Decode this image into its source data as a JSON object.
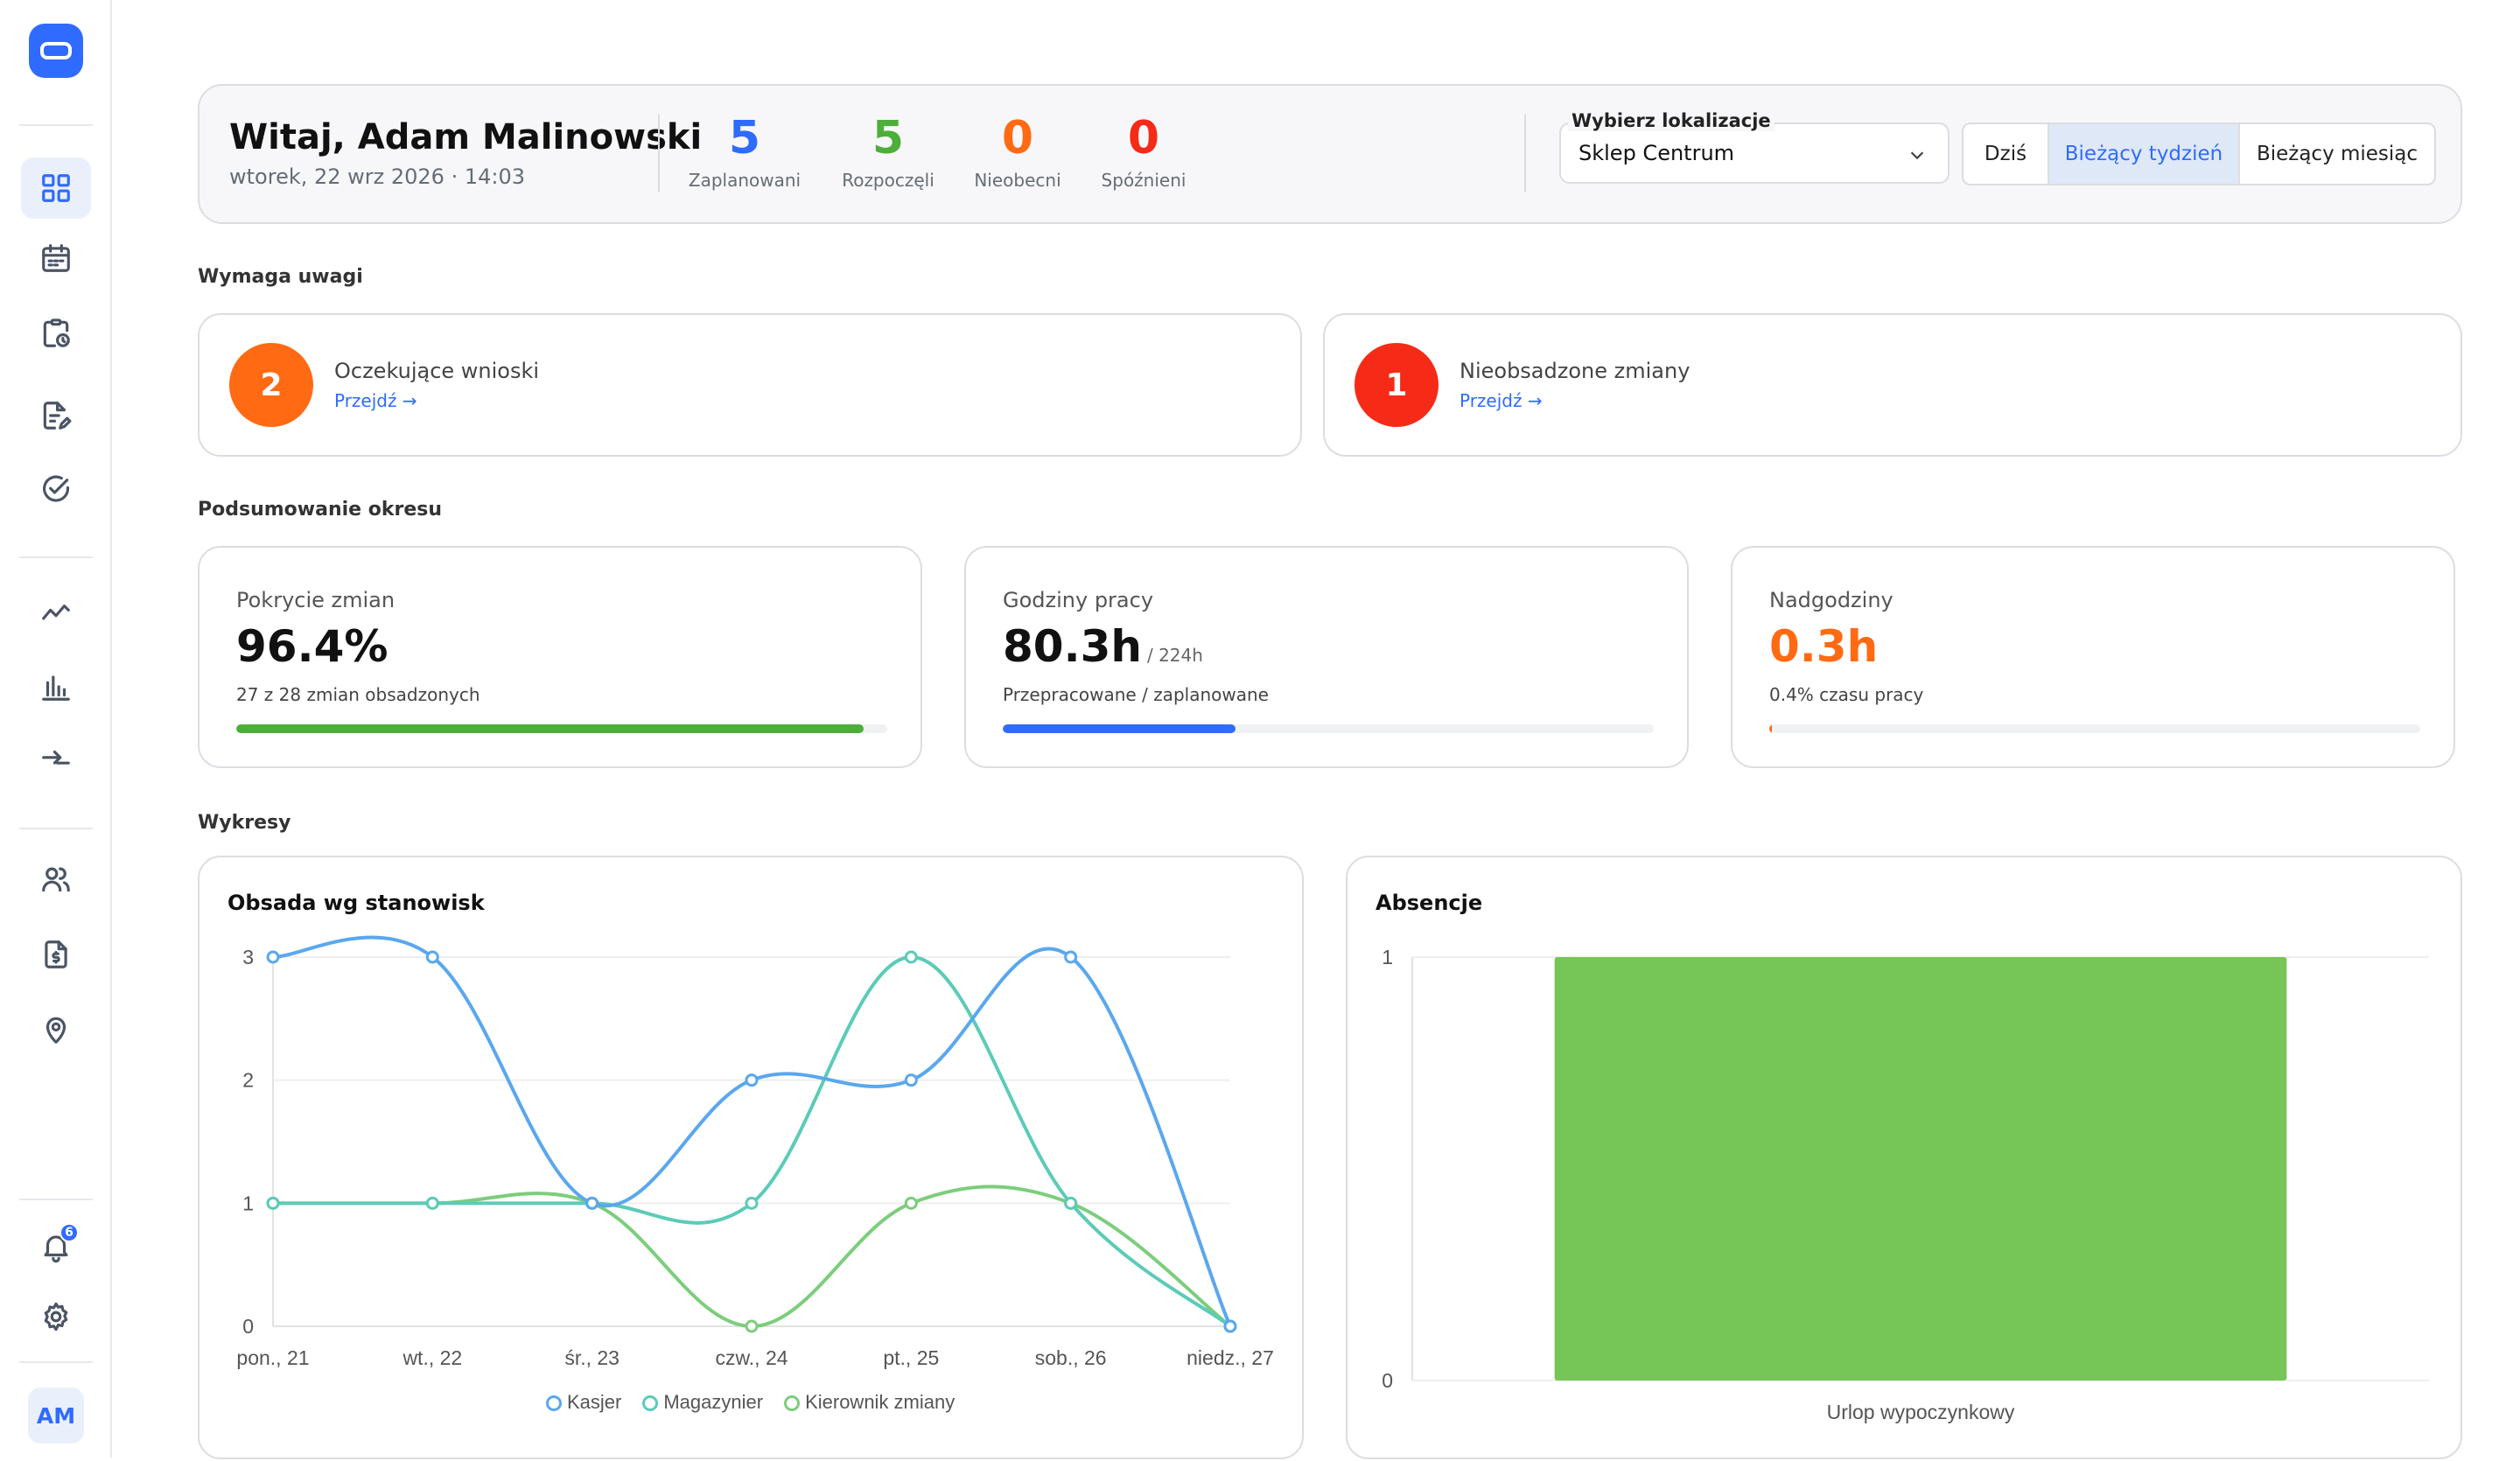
{
  "sidebar": {
    "avatar": "AM",
    "notifications_count": "6",
    "nav": [
      {
        "name": "dashboard-icon",
        "active": true
      },
      {
        "name": "calendar-icon"
      },
      {
        "name": "clipboard-clock-icon"
      },
      {
        "name": "document-edit-icon"
      },
      {
        "name": "check-circle-icon"
      },
      {
        "name": "trend-line-icon"
      },
      {
        "name": "bar-chart-icon"
      },
      {
        "name": "swap-arrows-icon"
      },
      {
        "name": "users-icon"
      },
      {
        "name": "document-dollar-icon"
      },
      {
        "name": "map-pin-icon"
      },
      {
        "name": "bell-icon"
      },
      {
        "name": "gear-icon"
      }
    ]
  },
  "header": {
    "greeting": "Witaj, Adam Malinowski",
    "datetime": "wtorek, 22 wrz 2026 · 14:03",
    "stats": [
      {
        "value": "5",
        "label": "Zaplanowani",
        "color": "#2f6bff"
      },
      {
        "value": "5",
        "label": "Rozpoczęli",
        "color": "#4caf3a"
      },
      {
        "value": "0",
        "label": "Nieobecni",
        "color": "#ff6a13"
      },
      {
        "value": "0",
        "label": "Spóźnieni",
        "color": "#f52b17"
      }
    ],
    "location_label": "Wybierz lokalizacje",
    "location_value": "Sklep Centrum",
    "periods": [
      "Dziś",
      "Bieżący tydzień",
      "Bieżący miesiąc"
    ],
    "active_period": "Bieżący tydzień"
  },
  "attention": {
    "title": "Wymaga uwagi",
    "cards": [
      {
        "count": "2",
        "label": "Oczekujące wnioski",
        "link": "Przejdź →",
        "color": "#ff6a13"
      },
      {
        "count": "1",
        "label": "Nieobsadzone zmiany",
        "link": "Przejdź →",
        "color": "#f52b17"
      }
    ]
  },
  "summary": {
    "title": "Podsumowanie okresu",
    "cards": [
      {
        "title": "Pokrycie zmian",
        "value": "96.4%",
        "suffix": "",
        "sub": "27 z 28 zmian obsadzonych",
        "progress": 0.964,
        "color": "#4caf3a",
        "value_color": "#111111"
      },
      {
        "title": "Godziny pracy",
        "value": "80.3h",
        "suffix": "/ 224h",
        "sub": "Przepracowane / zaplanowane",
        "progress": 0.358,
        "color": "#2f6bff",
        "value_color": "#111111"
      },
      {
        "title": "Nadgodziny",
        "value": "0.3h",
        "suffix": "",
        "sub": "0.4% czasu pracy",
        "progress": 0.004,
        "color": "#ff6a13",
        "value_color": "#ff6a13"
      }
    ]
  },
  "charts_title": "Wykresy",
  "chart_data": [
    {
      "type": "line",
      "title": "Obsada wg stanowisk",
      "categories": [
        "pon., 21",
        "wt., 22",
        "śr., 23",
        "czw., 24",
        "pt., 25",
        "sob., 26",
        "niedz., 27"
      ],
      "ylim": [
        0,
        3
      ],
      "yticks": [
        0,
        1,
        2,
        3
      ],
      "series": [
        {
          "name": "Kasjer",
          "color": "#5aa7ee",
          "values": [
            3,
            3,
            1,
            2,
            2,
            3,
            0
          ]
        },
        {
          "name": "Magazynier",
          "color": "#5ccbb8",
          "values": [
            1,
            1,
            1,
            1,
            3,
            1,
            0
          ]
        },
        {
          "name": "Kierownik zmiany",
          "color": "#7ccd7c",
          "values": [
            1,
            1,
            1,
            0,
            1,
            1,
            0
          ]
        }
      ],
      "grid": true,
      "legend": "bottom"
    },
    {
      "type": "bar",
      "title": "Absencje",
      "categories": [
        "Urlop wypoczynkowy"
      ],
      "values": [
        1
      ],
      "ylim": [
        0,
        1
      ],
      "yticks": [
        0,
        1
      ],
      "color": "#76c557",
      "grid": true
    }
  ]
}
